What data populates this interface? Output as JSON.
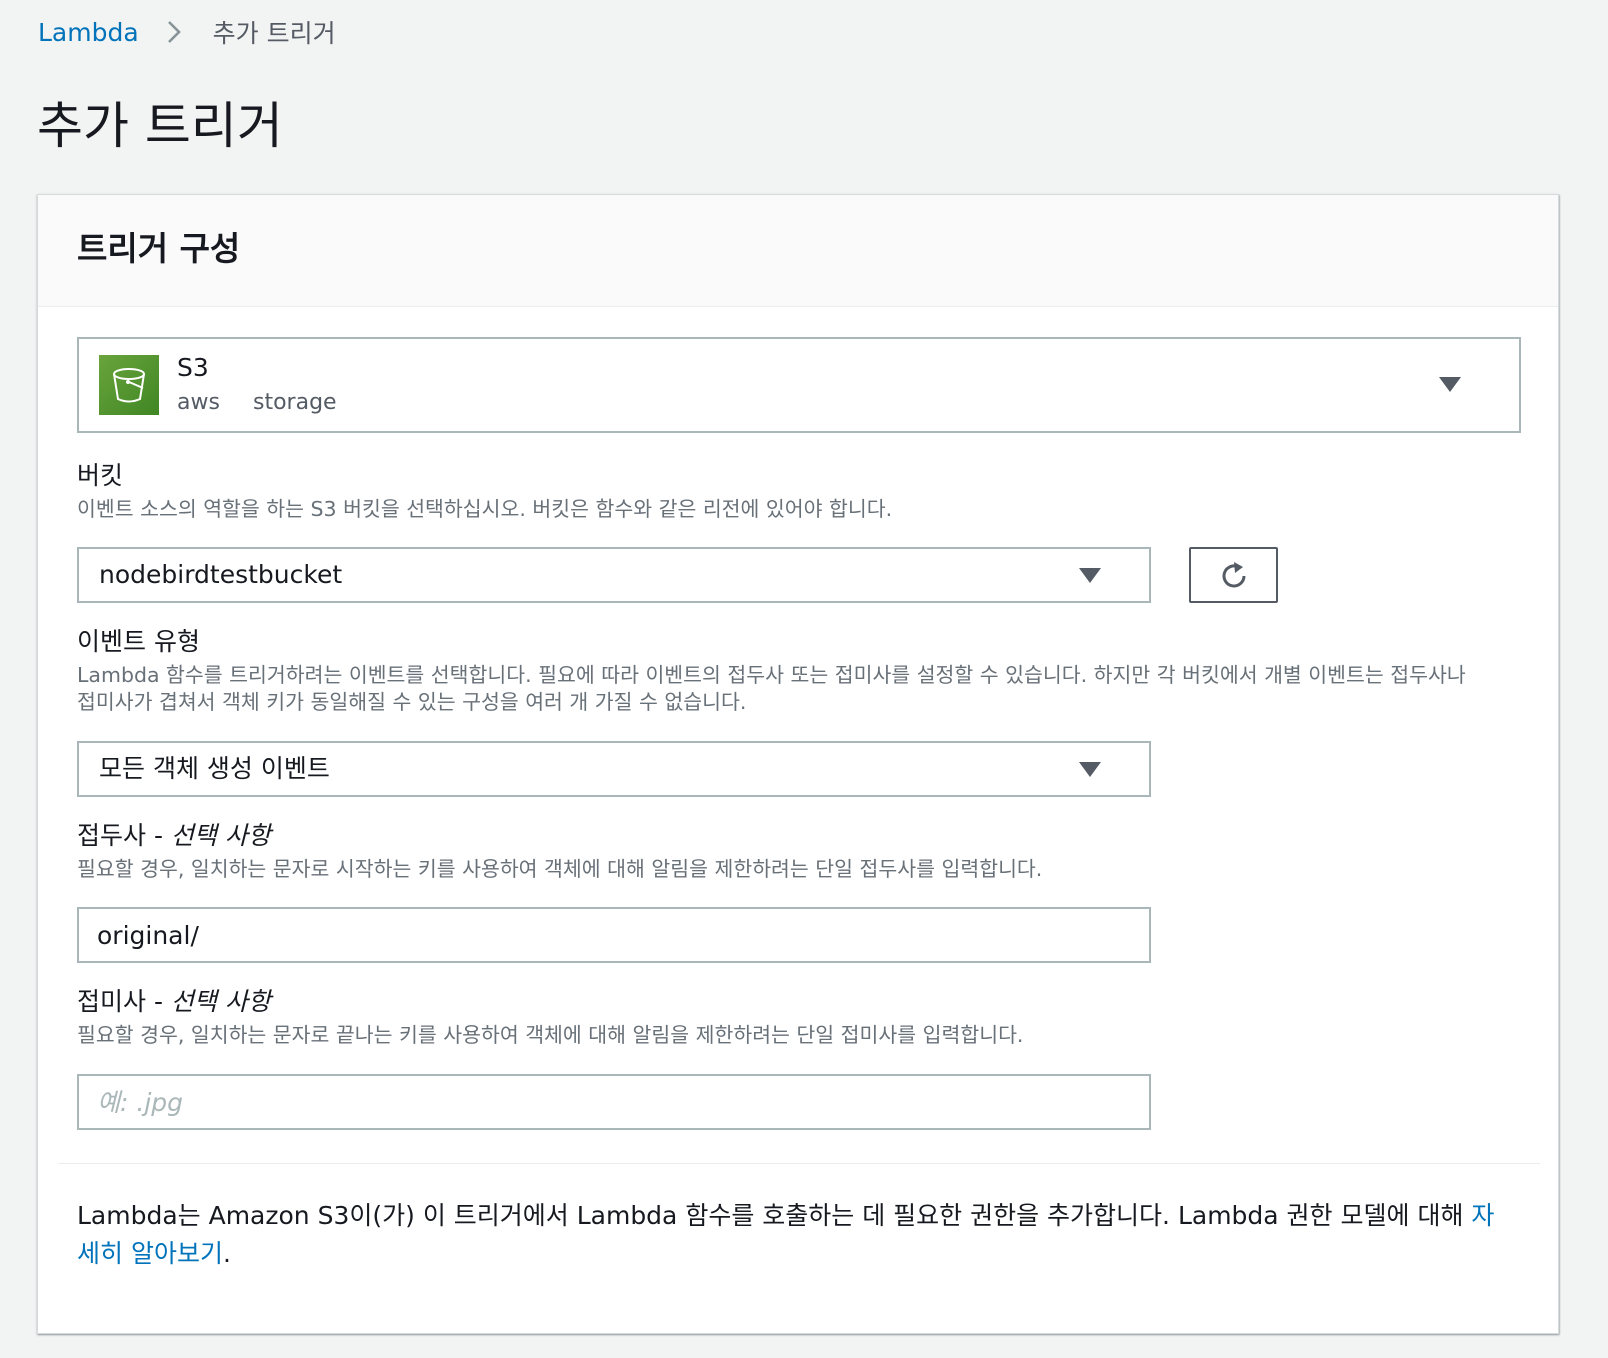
{
  "breadcrumb": {
    "root": "Lambda",
    "current": "추가 트리거"
  },
  "page_title": "추가 트리거",
  "panel": {
    "title": "트리거 구성",
    "trigger": {
      "name": "S3",
      "tags": [
        "aws",
        "storage"
      ],
      "icon": "s3-bucket-icon",
      "icon_color": "#3f8624"
    },
    "bucket": {
      "label": "버킷",
      "description": "이벤트 소스의 역할을 하는 S3 버킷을 선택하십시오. 버킷은 함수와 같은 리전에 있어야 합니다.",
      "value": "nodebirdtestbucket",
      "refresh_icon": "refresh-icon"
    },
    "event_type": {
      "label": "이벤트 유형",
      "description_line1": "Lambda 함수를 트리거하려는 이벤트를 선택합니다. 필요에 따라 이벤트의 접두사 또는 접미사를 설정할 수 있습니다. 하지만 각 버킷에서 개별 이벤트는 접두사나",
      "description_line2": "접미사가 겹쳐서 객체 키가 동일해질 수 있는 구성을 여러 개 가질 수 없습니다.",
      "value": "모든 객체 생성 이벤트"
    },
    "prefix": {
      "label": "접두사 - ",
      "optional": "선택 사항",
      "description": "필요할 경우, 일치하는 문자로 시작하는 키를 사용하여 객체에 대해 알림을 제한하려는 단일 접두사를 입력합니다.",
      "value": "original/"
    },
    "suffix": {
      "label": "접미사 - ",
      "optional": "선택 사항",
      "description": "필요할 경우, 일치하는 문자로 끝나는 키를 사용하여 객체에 대해 알림을 제한하려는 단일 접미사를 입력합니다.",
      "placeholder": "예: .jpg",
      "value": ""
    },
    "info": {
      "text": "Lambda는 Amazon S3이(가) 이 트리거에서 Lambda 함수를 호출하는 데 필요한 권한을 추가합니다. Lambda 권한 모델에 대해 ",
      "link": "자세히 알아보기",
      "end": "."
    }
  },
  "colors": {
    "link": "#0073bb",
    "background": "#f2f3f3",
    "border": "#aab7b8"
  }
}
